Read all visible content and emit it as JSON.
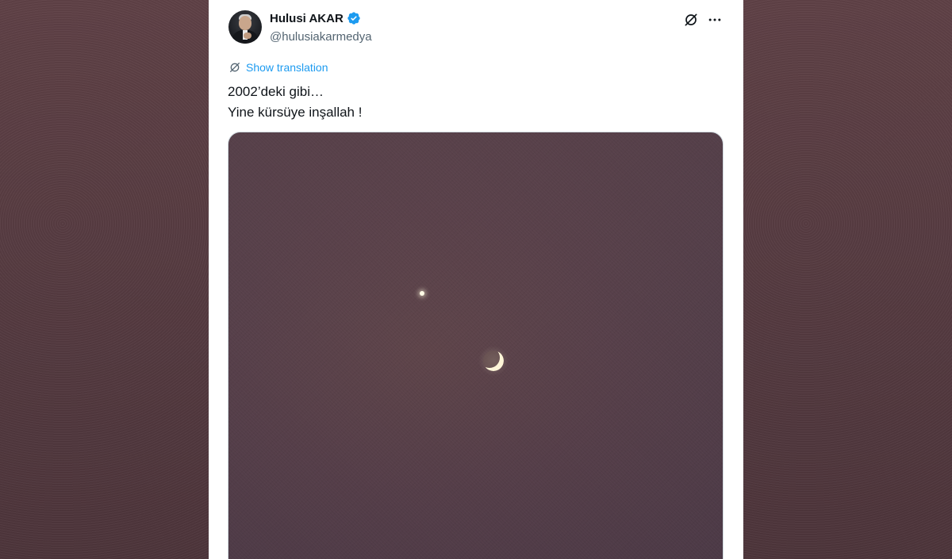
{
  "colors": {
    "accent": "#1d9bf0",
    "text_primary": "#0f1419",
    "text_secondary": "#536471",
    "backdrop": "#5b3d42",
    "media_sky": "#57404a"
  },
  "tweet": {
    "author": {
      "display_name": "Hulusi AKAR",
      "handle": "@hulusiakarmedya",
      "verified_icon": "verified-badge-icon"
    },
    "actions": {
      "grok_icon": "grok-icon",
      "more_icon": "more-horizontal-icon"
    },
    "translation": {
      "label": "Show translation",
      "icon": "translate-icon"
    },
    "text_lines": [
      "2002’deki gibi…",
      "Yine kürsüye inşallah !"
    ],
    "media": {
      "type": "photo",
      "subject_icons": [
        "planet-icon",
        "crescent-moon-icon"
      ]
    }
  }
}
